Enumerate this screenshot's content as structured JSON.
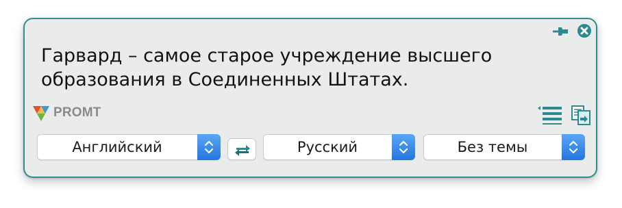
{
  "translation": {
    "text": "Гарвард – самое старое учреждение высшего\nобразования в Соединенных Штатах."
  },
  "brand": {
    "name": "PROMT"
  },
  "controls": {
    "source_language": "Английский",
    "target_language": "Русский",
    "topic": "Без темы"
  },
  "icons": {
    "pin": "pin-icon",
    "close": "close-icon",
    "logo": "promt-logo",
    "list": "list-icon",
    "copy": "copy-icon",
    "swap": "swap-icon",
    "select_arrows": "chevron-up-down-icon"
  },
  "colors": {
    "panel_background": "#eaecec",
    "panel_border": "#2e8f93",
    "accent": "#2e8f93",
    "select_arrow_background": "#2f80ed",
    "brand_text": "#8a8a8a"
  }
}
